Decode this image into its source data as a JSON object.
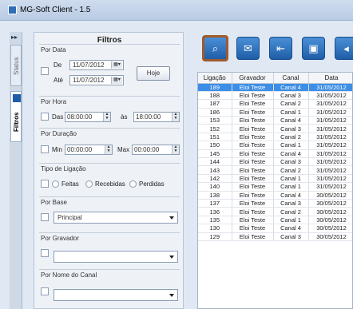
{
  "window": {
    "title": "MG-Soft Client - 1.5"
  },
  "side_tabs": {
    "status": "Status",
    "filtros": "Filtros"
  },
  "filters": {
    "title": "Filtros",
    "por_data": {
      "label": "Por Data",
      "de_label": "De",
      "de_value": "11/07/2012",
      "ate_label": "Até",
      "ate_value": "11/07/2012",
      "hoje_button": "Hoje"
    },
    "por_hora": {
      "label": "Por Hora",
      "das_label": "Das",
      "das_value": "08:00:00",
      "as_label": "às",
      "as_value": "18:00:00"
    },
    "por_duracao": {
      "label": "Por Duração",
      "min_label": "Min",
      "min_value": "00:00:00",
      "max_label": "Max",
      "max_value": "00:00:00"
    },
    "tipo_ligacao": {
      "label": "Tipo de Ligação",
      "feitas": "Feitas",
      "recebidas": "Recebidas",
      "perdidas": "Perdidas"
    },
    "por_base": {
      "label": "Por Base",
      "value": "Principal"
    },
    "por_gravador": {
      "label": "Por Gravador",
      "value": ""
    },
    "por_nome_canal": {
      "label": "Por Nome do Canal",
      "value": ""
    }
  },
  "toolbar": {
    "icons": [
      "search-icon",
      "mail-icon",
      "export-icon",
      "save-icon",
      "back-icon"
    ]
  },
  "table": {
    "columns": [
      "Ligação",
      "Gravador",
      "Canal",
      "Data"
    ],
    "rows": [
      [
        "189",
        "Eloi Teste",
        "Canal 4",
        "31/05/2012"
      ],
      [
        "188",
        "Eloi Teste",
        "Canal 3",
        "31/05/2012"
      ],
      [
        "187",
        "Eloi Teste",
        "Canal 2",
        "31/05/2012"
      ],
      [
        "186",
        "Eloi Teste",
        "Canal 1",
        "31/05/2012"
      ],
      [
        "153",
        "Eloi Teste",
        "Canal 4",
        "31/05/2012"
      ],
      [
        "152",
        "Eloi Teste",
        "Canal 3",
        "31/05/2012"
      ],
      [
        "151",
        "Eloi Teste",
        "Canal 2",
        "31/05/2012"
      ],
      [
        "150",
        "Eloi Teste",
        "Canal 1",
        "31/05/2012"
      ],
      [
        "145",
        "Eloi Teste",
        "Canal 4",
        "31/05/2012"
      ],
      [
        "144",
        "Eloi Teste",
        "Canal 3",
        "31/05/2012"
      ],
      [
        "143",
        "Eloi Teste",
        "Canal 2",
        "31/05/2012"
      ],
      [
        "142",
        "Eloi Teste",
        "Canal 1",
        "31/05/2012"
      ],
      [
        "140",
        "Eloi Teste",
        "Canal 1",
        "31/05/2012"
      ],
      [
        "138",
        "Eloi Teste",
        "Canal 4",
        "30/05/2012"
      ],
      [
        "137",
        "Eloi Teste",
        "Canal 3",
        "30/05/2012"
      ],
      [
        "136",
        "Eloi Teste",
        "Canal 2",
        "30/05/2012"
      ],
      [
        "135",
        "Eloi Teste",
        "Canal 1",
        "30/05/2012"
      ],
      [
        "130",
        "Eloi Teste",
        "Canal 4",
        "30/05/2012"
      ],
      [
        "129",
        "Eloi Teste",
        "Canal 3",
        "30/05/2012"
      ]
    ],
    "selected_index": 0
  }
}
